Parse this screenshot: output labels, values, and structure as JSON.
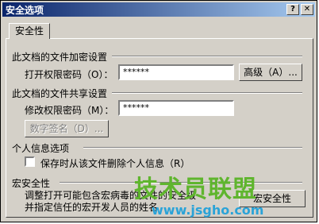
{
  "window": {
    "title": "安全选项"
  },
  "tab": {
    "label": "安全性"
  },
  "encrypt": {
    "heading": "此文档的文件加密设置",
    "open_label": "打开权限密码（O）：",
    "open_value": "******",
    "advanced_button": "高级（A）..."
  },
  "share": {
    "heading": "此文档的文件共享设置",
    "modify_label": "修改权限密码（M）：",
    "modify_value": "******",
    "signature_button": "数字签名（D）..."
  },
  "privacy": {
    "heading": "个人信息选项",
    "remove_label": "保存时从该文件删除个人信息（R）",
    "remove_checked": false
  },
  "macro": {
    "heading": "宏安全性",
    "desc_line1": "调整打开可能包含宏病毒的文件的安全级",
    "desc_line2": "并指定信任的宏开发人员的姓名",
    "button": "宏安全性"
  },
  "watermark": {
    "cn": "技术员联盟",
    "url": "www.jsgho.com"
  }
}
